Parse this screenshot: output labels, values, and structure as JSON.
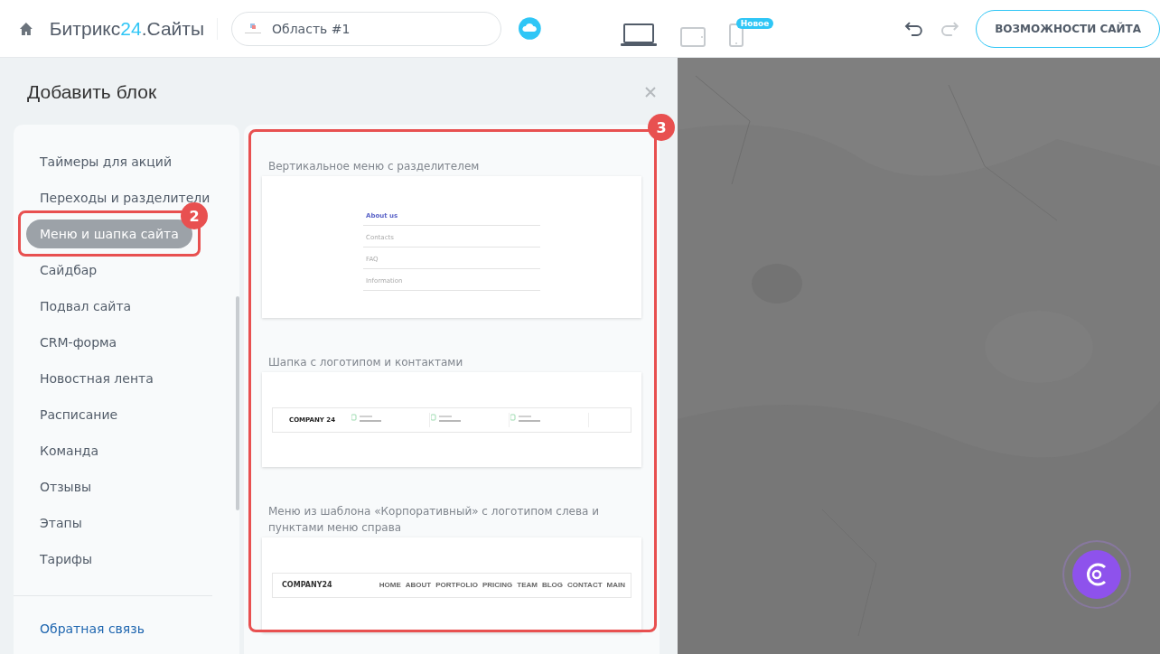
{
  "header": {
    "logo_brand": "Битрикс",
    "logo_number": "24",
    "logo_suffix": ".Сайты",
    "site_field": "Область #1",
    "devices": [
      {
        "kind": "desktop",
        "selected": true
      },
      {
        "kind": "tablet",
        "selected": false
      },
      {
        "kind": "phone",
        "selected": false,
        "badge": "Новое"
      }
    ],
    "undo": {
      "disabled": false
    },
    "redo": {
      "disabled": true
    },
    "features_button": "ВОЗМОЖНОСТИ САЙТА"
  },
  "panel": {
    "title": "Добавить блок",
    "categories": [
      {
        "label": "Таймеры для акций",
        "selected": false
      },
      {
        "label": "Переходы и разделители",
        "selected": false
      },
      {
        "label": "Меню и шапка сайта",
        "selected": true,
        "annotation": "2"
      },
      {
        "label": "Сайдбар",
        "selected": false
      },
      {
        "label": "Подвал сайта",
        "selected": false
      },
      {
        "label": "CRM-форма",
        "selected": false
      },
      {
        "label": "Новостная лента",
        "selected": false
      },
      {
        "label": "Расписание",
        "selected": false
      },
      {
        "label": "Команда",
        "selected": false
      },
      {
        "label": "Отзывы",
        "selected": false
      },
      {
        "label": "Этапы",
        "selected": false
      },
      {
        "label": "Тарифы",
        "selected": false
      }
    ],
    "feedback_link": "Обратная связь",
    "blocks_annotation": "3",
    "blocks": [
      {
        "kind": "vertical-menu",
        "title": "Вертикальное меню с разделителем",
        "items": [
          {
            "label": "About us",
            "selected": true
          },
          {
            "label": "Contacts",
            "selected": false
          },
          {
            "label": "FAQ",
            "selected": false
          },
          {
            "label": "Information",
            "selected": false
          }
        ]
      },
      {
        "kind": "header-contacts",
        "title": "Шапка с логотипом и контактами",
        "logo": "COMPANY 24"
      },
      {
        "kind": "top-menu",
        "title": "Меню из шаблона «Корпоративный» с логотипом слева и пунктами меню справа",
        "logo": "COMPANY24",
        "items": [
          "HOME",
          "ABOUT",
          "PORTFOLIO",
          "PRICING",
          "TEAM",
          "BLOG",
          "CONTACT",
          "MAIN"
        ]
      }
    ]
  }
}
